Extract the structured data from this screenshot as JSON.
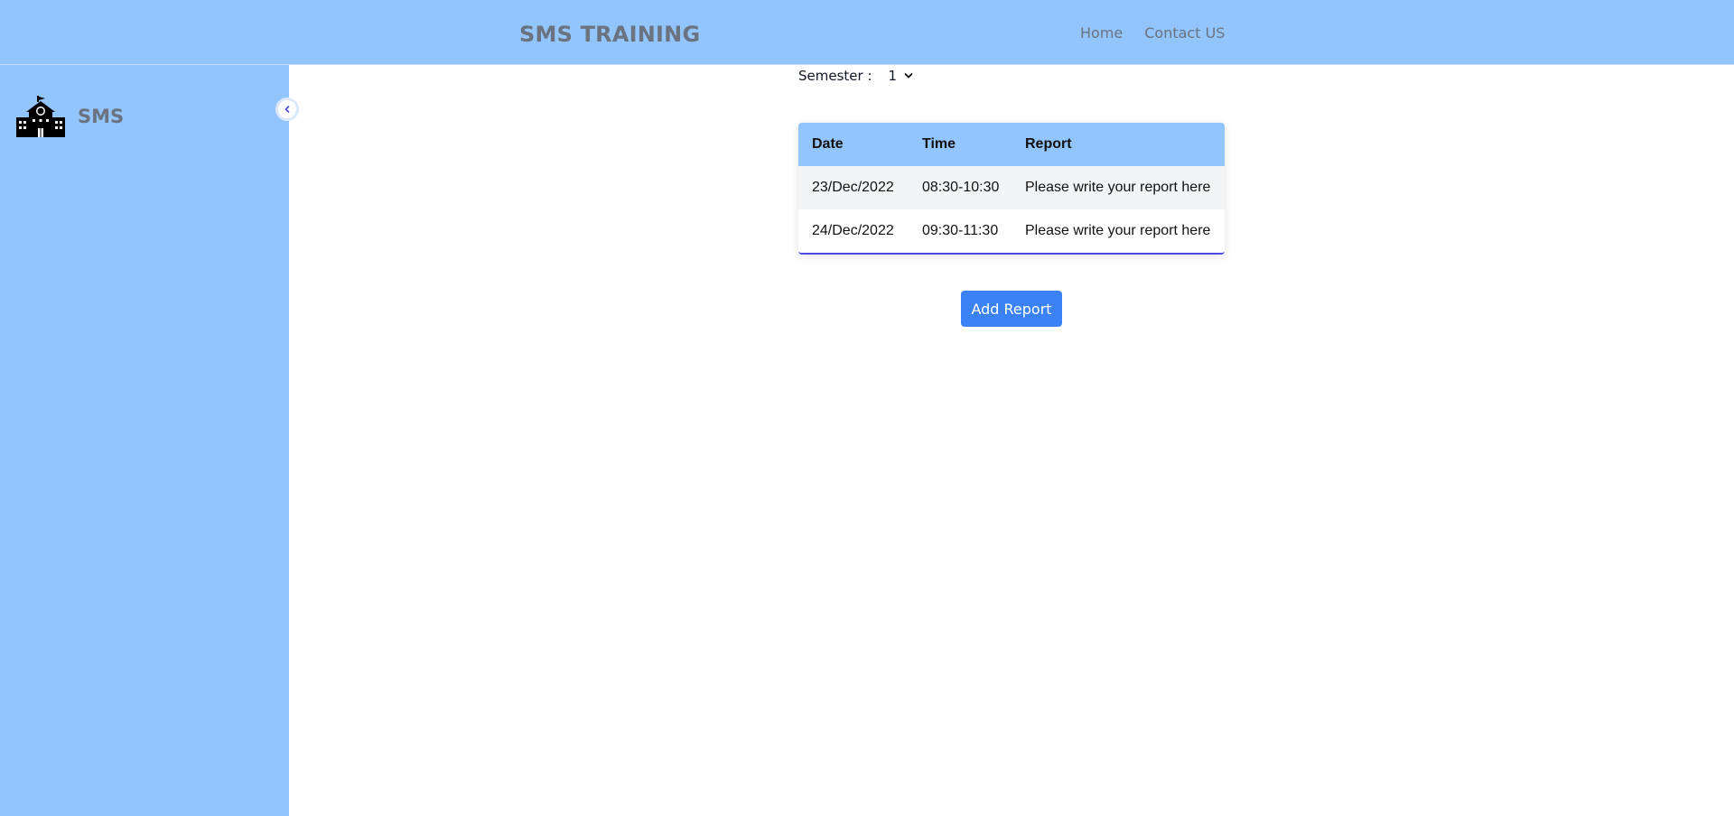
{
  "header": {
    "title": "SMS TRAINING",
    "nav": [
      "Home",
      "Contact US"
    ]
  },
  "sidebar": {
    "brand": "SMS",
    "brand_icon": "school-building-icon",
    "collapse_icon": "chevron-left-icon"
  },
  "filter": {
    "label": "Semester :",
    "selected": "1"
  },
  "table": {
    "headers": [
      "Date",
      "Time",
      "Report"
    ],
    "rows": [
      [
        "23/Dec/2022",
        "08:30-10:30",
        "Please write your report here"
      ],
      [
        "24/Dec/2022",
        "09:30-11:30",
        "Please write your report here"
      ]
    ]
  },
  "actions": {
    "add_report": "Add Report"
  },
  "colors": {
    "nav_bg": "#93c5fd",
    "button": "#3b82f6",
    "accent_line": "#4f46e5",
    "muted_text": "#6b7280"
  }
}
